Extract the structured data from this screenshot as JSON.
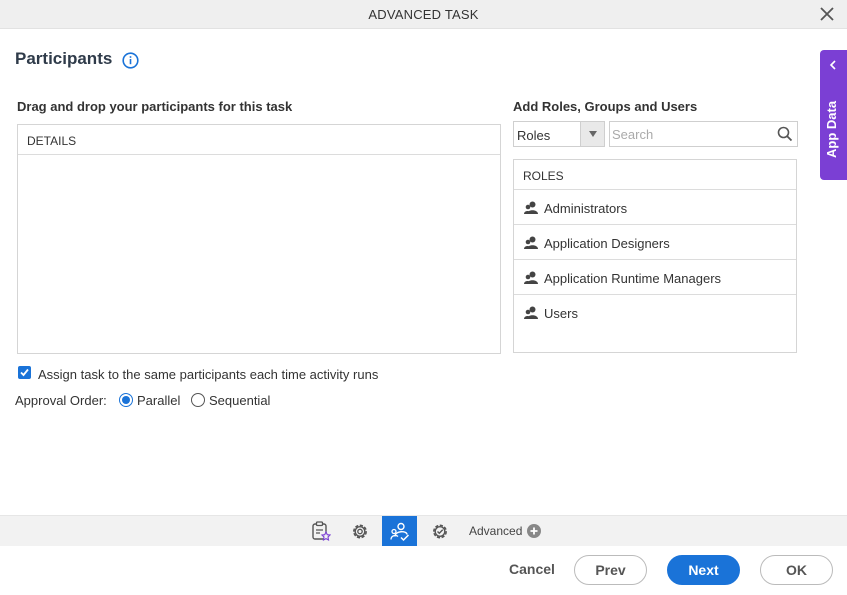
{
  "window": {
    "title": "ADVANCED TASK"
  },
  "section": {
    "title": "Participants"
  },
  "app_data_tab": {
    "label": "App Data"
  },
  "left_panel": {
    "label": "Drag and drop your participants for this task",
    "header": "DETAILS"
  },
  "right_panel": {
    "label": "Add Roles, Groups and Users",
    "type_select": {
      "value": "Roles"
    },
    "search": {
      "placeholder": "Search",
      "value": ""
    },
    "list_header": "ROLES",
    "roles": [
      {
        "label": "Administrators"
      },
      {
        "label": "Application Designers"
      },
      {
        "label": "Application Runtime Managers"
      },
      {
        "label": "Users"
      }
    ]
  },
  "options": {
    "assign_same": {
      "label": "Assign task to the same participants each time activity runs",
      "checked": true
    },
    "approval_order": {
      "label": "Approval Order:",
      "choices": [
        {
          "label": "Parallel",
          "selected": true
        },
        {
          "label": "Sequential",
          "selected": false
        }
      ]
    }
  },
  "toolbar": {
    "advanced_label": "Advanced",
    "tabs": [
      {
        "icon": "task-form-icon"
      },
      {
        "icon": "settings-gear-icon"
      },
      {
        "icon": "participants-icon",
        "active": true
      },
      {
        "icon": "advanced-settings-gear-icon"
      }
    ]
  },
  "footer": {
    "cancel_label": "Cancel",
    "prev_label": "Prev",
    "next_label": "Next",
    "ok_label": "OK"
  },
  "colors": {
    "accent": "#1a73d8",
    "app_data_tab": "#7b3fd4",
    "heading": "#2f3b4a"
  }
}
